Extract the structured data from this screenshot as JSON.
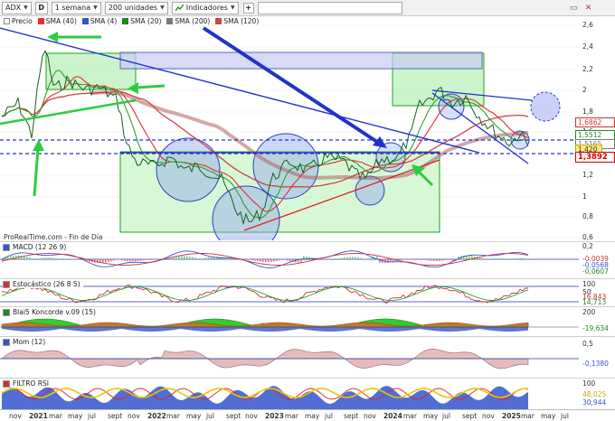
{
  "toolbar": {
    "symbol": "ADX",
    "period_button": "D",
    "timeframe": "1 semana",
    "units": "200 unidades",
    "indicators": "Indicadores"
  },
  "main_legend": [
    {
      "label": "Precio",
      "color": "#ffffff"
    },
    {
      "label": "SMA (40)",
      "color": "#e03030"
    },
    {
      "label": "SMA (4)",
      "color": "#3355cc"
    },
    {
      "label": "SMA (20)",
      "color": "#228822"
    },
    {
      "label": "SMA (200)",
      "color": "#7a7a7a"
    },
    {
      "label": "SMA (120)",
      "color": "#cc4444"
    }
  ],
  "price_axis": [
    "2,6",
    "2,4",
    "2,2",
    "2",
    "1,8",
    "1,6",
    "1,2",
    "1",
    "0,8",
    "0,6"
  ],
  "price_tags": [
    {
      "label": "1,6862",
      "color": "#cc3333"
    },
    {
      "label": "1,5512",
      "color": "#228822"
    },
    {
      "label": "1,5165",
      "color": "#7a7a7a"
    },
    {
      "label": "1,420",
      "color": "#333333"
    },
    {
      "label": "1,3892",
      "color": "#cc0000"
    }
  ],
  "credit": "ProRealTime.com - Fin de Día",
  "panels": [
    {
      "title": "MACD (12 26 9)",
      "axis": [
        "0,2",
        "0",
        "-0,2"
      ],
      "values": [
        "-0,0039",
        "-0,0568",
        "-0,0607"
      ],
      "swatch": "#3355cc"
    },
    {
      "title": "Estocástico (26 8 5)",
      "axis": [
        "100",
        "50",
        "0"
      ],
      "values": [
        "16,843",
        "14,713"
      ],
      "swatch": "#cc3333"
    },
    {
      "title": "Blai5 Koncorde v.09 (15)",
      "axis": [
        "200",
        "0",
        "-200"
      ],
      "values": [
        "-19,634"
      ],
      "swatch": "#228822"
    },
    {
      "title": "Mom (12)",
      "axis": [
        "0,5",
        "0",
        "-0,5"
      ],
      "values": [
        "-0,1380"
      ],
      "swatch": "#3355cc"
    },
    {
      "title": "FILTRO RSI",
      "axis": [
        "100",
        "50",
        "0"
      ],
      "values": [
        "48,025",
        "30,944"
      ],
      "swatch": "#cc3333"
    }
  ],
  "time_axis": [
    {
      "label": "nov",
      "year": false
    },
    {
      "label": "2021",
      "year": true
    },
    {
      "label": "mar",
      "year": false
    },
    {
      "label": "may",
      "year": false
    },
    {
      "label": "jul",
      "year": false
    },
    {
      "label": "sept",
      "year": false
    },
    {
      "label": "nov",
      "year": false
    },
    {
      "label": "2022",
      "year": true
    },
    {
      "label": "mar",
      "year": false
    },
    {
      "label": "may",
      "year": false
    },
    {
      "label": "jul",
      "year": false
    },
    {
      "label": "sept",
      "year": false
    },
    {
      "label": "nov",
      "year": false
    },
    {
      "label": "2023",
      "year": true
    },
    {
      "label": "mar",
      "year": false
    },
    {
      "label": "may",
      "year": false
    },
    {
      "label": "jul",
      "year": false
    },
    {
      "label": "sept",
      "year": false
    },
    {
      "label": "nov",
      "year": false
    },
    {
      "label": "2024",
      "year": true
    },
    {
      "label": "mar",
      "year": false
    },
    {
      "label": "may",
      "year": false
    },
    {
      "label": "jul",
      "year": false
    },
    {
      "label": "sept",
      "year": false
    },
    {
      "label": "nov",
      "year": false
    },
    {
      "label": "2025",
      "year": true
    },
    {
      "label": "mar",
      "year": false
    },
    {
      "label": "may",
      "year": false
    },
    {
      "label": "jul",
      "year": false
    }
  ],
  "colors": {
    "price_line": "#1b5e20",
    "sma4": "#3355cc",
    "sma20": "#228822",
    "sma40": "#e03030",
    "sma120": "#cc4444",
    "sma200": "#7a7a7a",
    "green_fill": "#b6f0b6",
    "blue_fill": "#c9ccf2",
    "annotation_green": "#2ecc40",
    "annotation_blue": "#2233cc"
  }
}
